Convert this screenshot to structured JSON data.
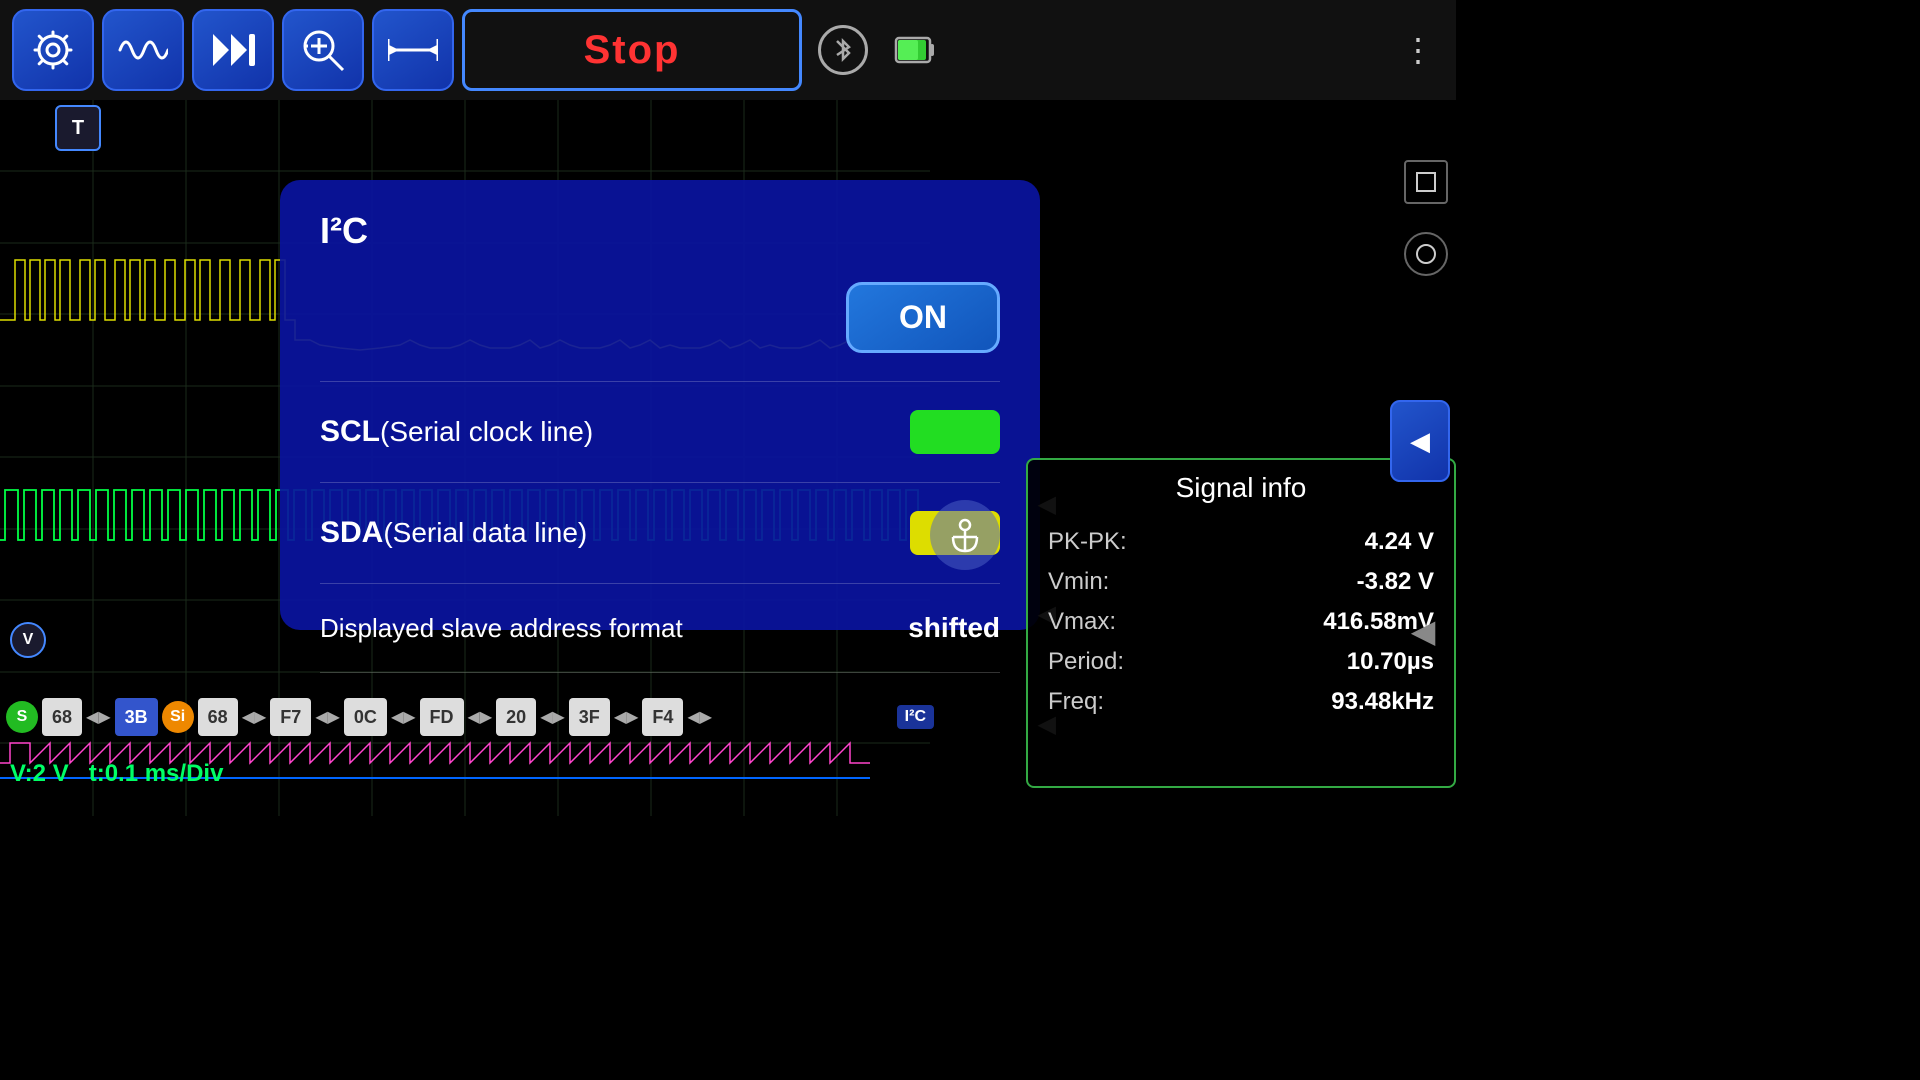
{
  "toolbar": {
    "settings_label": "⚙",
    "waveform_label": "∿",
    "play_pause_label": "▶⏸",
    "zoom_label": "⊕",
    "fit_label": "↔",
    "stop_label": "Stop",
    "more_label": "⋮"
  },
  "status_bar": {
    "voltage": "V:2 V",
    "time_div": "t:0.1 ms/Div"
  },
  "i2c_overlay": {
    "title": "I²C",
    "on_label": "ON",
    "scl_label": "SCL",
    "scl_desc": "(Serial clock line)",
    "sda_label": "SDA",
    "sda_desc": "(Serial data line)",
    "address_label": "Displayed slave address format",
    "address_value": "shifted"
  },
  "signal_info": {
    "title": "Signal info",
    "pk_pk_label": "PK-PK:",
    "pk_pk_value": "4.24 V",
    "vmin_label": "Vmin:",
    "vmin_value": "-3.82 V",
    "vmax_label": "Vmax:",
    "vmax_value": "416.58mV",
    "period_label": "Period:",
    "period_value": "10.70µs",
    "freq_label": "Freq:",
    "freq_value": "93.48kHz"
  },
  "i2c_data": {
    "badges": [
      "S",
      "68",
      "3B",
      "Si",
      "68",
      "F7",
      "0C",
      "FD",
      "20",
      "3F",
      "F4"
    ],
    "channel_label": "I²C"
  },
  "markers": {
    "t_label": "T",
    "v_label": "V"
  }
}
